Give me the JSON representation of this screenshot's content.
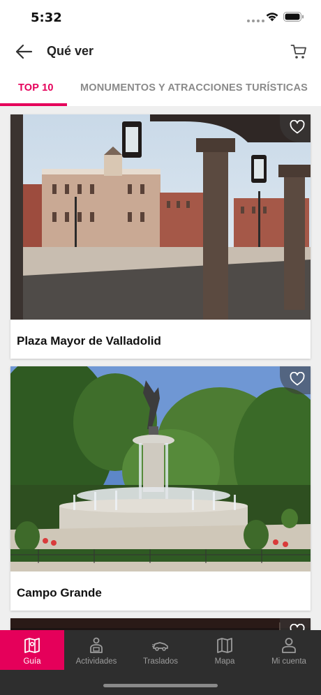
{
  "status_bar": {
    "time": "5:32"
  },
  "header": {
    "title": "Qué ver",
    "back_icon": "arrow-left-icon",
    "cart_icon": "cart-icon"
  },
  "tabs": [
    {
      "label": "TOP 10",
      "active": true
    },
    {
      "label": "MONUMENTOS Y ATRACCIONES TURÍSTICAS",
      "active": false
    }
  ],
  "cards": [
    {
      "title": "Plaza Mayor de Valladolid",
      "favorite_icon": "heart-outline-icon"
    },
    {
      "title": "Campo Grande",
      "favorite_icon": "heart-outline-icon"
    },
    {
      "title": "",
      "favorite_icon": "heart-outline-icon"
    }
  ],
  "bottom_nav": [
    {
      "label": "Guía",
      "icon": "map-guide-icon",
      "active": true
    },
    {
      "label": "Actividades",
      "icon": "person-activity-icon",
      "active": false
    },
    {
      "label": "Traslados",
      "icon": "car-transfer-icon",
      "active": false
    },
    {
      "label": "Mapa",
      "icon": "map-icon",
      "active": false
    },
    {
      "label": "Mi cuenta",
      "icon": "user-account-icon",
      "active": false
    }
  ],
  "colors": {
    "accent": "#e5005a",
    "nav_background": "#2e2e2e",
    "inactive_tab": "#8a8a8a"
  }
}
